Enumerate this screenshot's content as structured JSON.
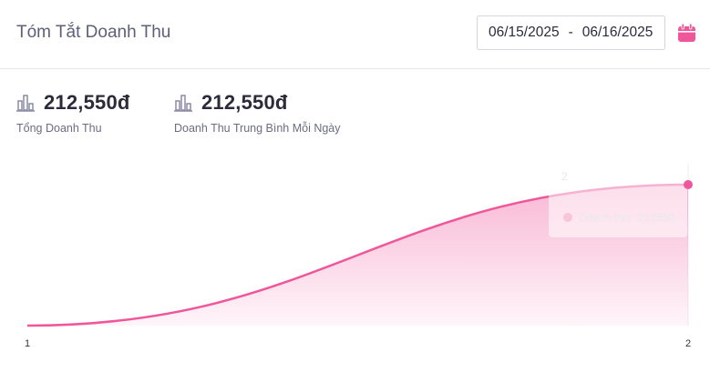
{
  "header": {
    "title": "Tóm Tắt Doanh Thu",
    "date_start": "06/15/2025",
    "date_separator": "-",
    "date_end": "06/16/2025"
  },
  "stats": [
    {
      "value": "212,550đ",
      "label": "Tổng Doanh Thu",
      "icon": "bar-chart-icon"
    },
    {
      "value": "212,550đ",
      "label": "Doanh Thu Trung Bình Mỗi Ngày",
      "icon": "bar-chart-icon"
    }
  ],
  "chart_data": {
    "type": "area",
    "x": [
      1,
      2
    ],
    "series": [
      {
        "name": "Doanh thu",
        "values": [
          0,
          212550
        ]
      }
    ],
    "x_ticks": [
      "1",
      "2"
    ],
    "tooltip": {
      "title": "2",
      "label": "Doanh thu:",
      "value": "212550"
    },
    "color": "#f0569a"
  },
  "colors": {
    "accent": "#f0569a",
    "title": "#5d6079",
    "border": "#e6e6ec"
  }
}
